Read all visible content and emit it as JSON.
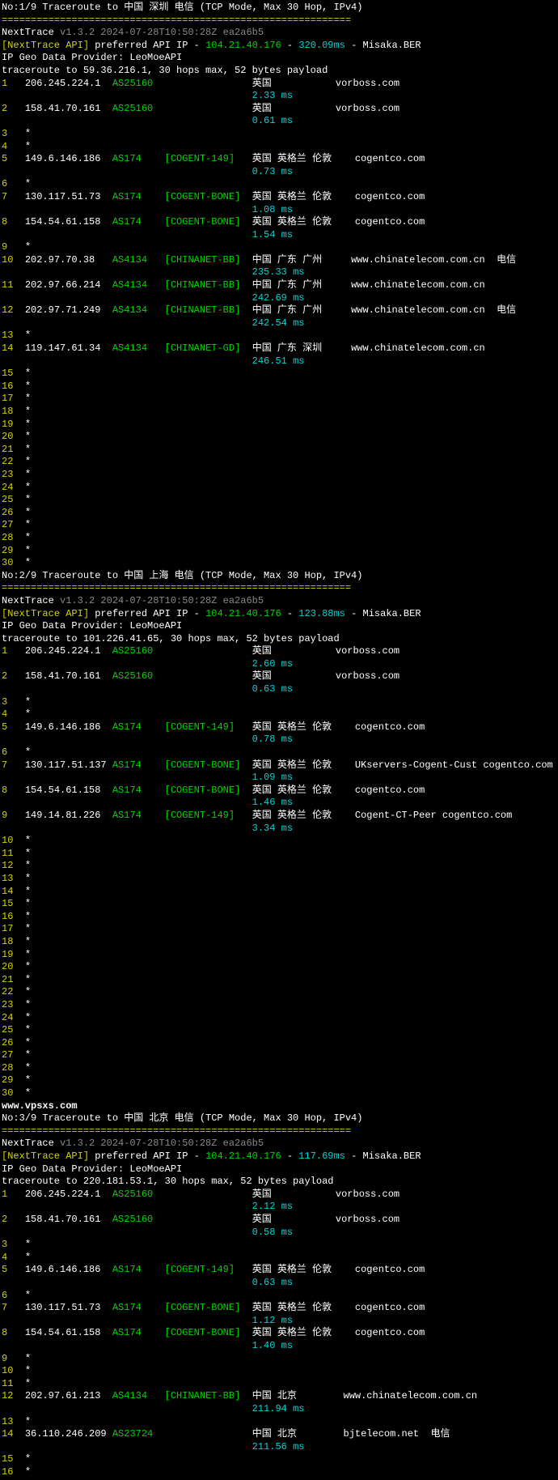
{
  "traces": [
    {
      "header": "No:1/9 Traceroute to 中国 深圳 电信 (TCP Mode, Max 30 Hop, IPv4)",
      "sep": "============================================================",
      "title": "NextTrace",
      "version": "v1.3.2 2024-07-28T10:50:28Z ea2a6b5",
      "api_label": "[NextTrace API]",
      "api_text": " preferred API IP - ",
      "api_ip": "104.21.40.176",
      "api_dash": " - ",
      "api_ms": "320.09ms",
      "api_suffix": " - Misaka.BER",
      "geo": "IP Geo Data Provider: LeoMoeAPI",
      "target": "traceroute to 59.36.216.1, 30 hops max, 52 bytes payload",
      "hops": [
        {
          "n": "1",
          "ip": "206.245.224.1",
          "as": "AS25160",
          "asname": "",
          "loc": "英国",
          "host": "vorboss.com",
          "ms": "2.33 ms"
        },
        {
          "n": "2",
          "ip": "158.41.70.161",
          "as": "AS25160",
          "asname": "",
          "loc": "英国",
          "host": "vorboss.com",
          "ms": "0.61 ms"
        },
        {
          "n": "3",
          "ip": "*",
          "star": true
        },
        {
          "n": "4",
          "ip": "*",
          "star": true
        },
        {
          "n": "5",
          "ip": "149.6.146.186",
          "as": "AS174",
          "asname": "[COGENT-149]",
          "loc": "英国 英格兰 伦敦",
          "host": "cogentco.com",
          "ms": "0.73 ms"
        },
        {
          "n": "6",
          "ip": "*",
          "star": true
        },
        {
          "n": "7",
          "ip": "130.117.51.73",
          "as": "AS174",
          "asname": "[COGENT-BONE]",
          "loc": "英国 英格兰 伦敦",
          "host": "cogentco.com",
          "ms": "1.08 ms"
        },
        {
          "n": "8",
          "ip": "154.54.61.158",
          "as": "AS174",
          "asname": "[COGENT-BONE]",
          "loc": "英国 英格兰 伦敦",
          "host": "cogentco.com",
          "ms": "1.54 ms"
        },
        {
          "n": "9",
          "ip": "*",
          "star": true
        },
        {
          "n": "10",
          "ip": "202.97.70.38",
          "as": "AS4134",
          "asname": "[CHINANET-BB]",
          "loc": "中国 广东 广州",
          "host": "www.chinatelecom.com.cn  电信",
          "ms": "235.33 ms"
        },
        {
          "n": "11",
          "ip": "202.97.66.214",
          "as": "AS4134",
          "asname": "[CHINANET-BB]",
          "loc": "中国 广东 广州",
          "host": "www.chinatelecom.com.cn",
          "ms": "242.69 ms"
        },
        {
          "n": "12",
          "ip": "202.97.71.249",
          "as": "AS4134",
          "asname": "[CHINANET-BB]",
          "loc": "中国 广东 广州",
          "host": "www.chinatelecom.com.cn  电信",
          "ms": "242.54 ms"
        },
        {
          "n": "13",
          "ip": "*",
          "star": true
        },
        {
          "n": "14",
          "ip": "119.147.61.34",
          "as": "AS4134",
          "asname": "[CHINANET-GD]",
          "loc": "中国 广东 深圳",
          "host": "www.chinatelecom.com.cn",
          "ms": "246.51 ms"
        },
        {
          "n": "15",
          "ip": "*",
          "star": true
        },
        {
          "n": "16",
          "ip": "*",
          "star": true
        },
        {
          "n": "17",
          "ip": "*",
          "star": true
        },
        {
          "n": "18",
          "ip": "*",
          "star": true
        },
        {
          "n": "19",
          "ip": "*",
          "star": true
        },
        {
          "n": "20",
          "ip": "*",
          "star": true
        },
        {
          "n": "21",
          "ip": "*",
          "star": true
        },
        {
          "n": "22",
          "ip": "*",
          "star": true
        },
        {
          "n": "23",
          "ip": "*",
          "star": true
        },
        {
          "n": "24",
          "ip": "*",
          "star": true
        },
        {
          "n": "25",
          "ip": "*",
          "star": true
        },
        {
          "n": "26",
          "ip": "*",
          "star": true
        },
        {
          "n": "27",
          "ip": "*",
          "star": true
        },
        {
          "n": "28",
          "ip": "*",
          "star": true
        },
        {
          "n": "29",
          "ip": "*",
          "star": true
        },
        {
          "n": "30",
          "ip": "*",
          "star": true
        }
      ]
    },
    {
      "header": "No:2/9 Traceroute to 中国 上海 电信 (TCP Mode, Max 30 Hop, IPv4)",
      "sep": "============================================================",
      "title": "NextTrace",
      "version": "v1.3.2 2024-07-28T10:50:28Z ea2a6b5",
      "api_label": "[NextTrace API]",
      "api_text": " preferred API IP - ",
      "api_ip": "104.21.40.176",
      "api_dash": " - ",
      "api_ms": "123.88ms",
      "api_suffix": " - Misaka.BER",
      "geo": "IP Geo Data Provider: LeoMoeAPI",
      "target": "traceroute to 101.226.41.65, 30 hops max, 52 bytes payload",
      "hops": [
        {
          "n": "1",
          "ip": "206.245.224.1",
          "as": "AS25160",
          "asname": "",
          "loc": "英国",
          "host": "vorboss.com",
          "ms": "2.60 ms"
        },
        {
          "n": "2",
          "ip": "158.41.70.161",
          "as": "AS25160",
          "asname": "",
          "loc": "英国",
          "host": "vorboss.com",
          "ms": "0.63 ms"
        },
        {
          "n": "3",
          "ip": "*",
          "star": true
        },
        {
          "n": "4",
          "ip": "*",
          "star": true
        },
        {
          "n": "5",
          "ip": "149.6.146.186",
          "as": "AS174",
          "asname": "[COGENT-149]",
          "loc": "英国 英格兰 伦敦",
          "host": "cogentco.com",
          "ms": "0.78 ms"
        },
        {
          "n": "6",
          "ip": "*",
          "star": true
        },
        {
          "n": "7",
          "ip": "130.117.51.137",
          "as": "AS174",
          "asname": "[COGENT-BONE]",
          "loc": "英国 英格兰 伦敦",
          "host": "UKservers-Cogent-Cust cogentco.com",
          "ms": "1.09 ms"
        },
        {
          "n": "8",
          "ip": "154.54.61.158",
          "as": "AS174",
          "asname": "[COGENT-BONE]",
          "loc": "英国 英格兰 伦敦",
          "host": "cogentco.com",
          "ms": "1.46 ms"
        },
        {
          "n": "9",
          "ip": "149.14.81.226",
          "as": "AS174",
          "asname": "[COGENT-149]",
          "loc": "英国 英格兰 伦敦",
          "host": "Cogent-CT-Peer cogentco.com",
          "ms": "3.34 ms"
        },
        {
          "n": "10",
          "ip": "*",
          "star": true
        },
        {
          "n": "11",
          "ip": "*",
          "star": true
        },
        {
          "n": "12",
          "ip": "*",
          "star": true
        },
        {
          "n": "13",
          "ip": "*",
          "star": true
        },
        {
          "n": "14",
          "ip": "*",
          "star": true
        },
        {
          "n": "15",
          "ip": "*",
          "star": true
        },
        {
          "n": "16",
          "ip": "*",
          "star": true
        },
        {
          "n": "17",
          "ip": "*",
          "star": true
        },
        {
          "n": "18",
          "ip": "*",
          "star": true
        },
        {
          "n": "19",
          "ip": "*",
          "star": true
        },
        {
          "n": "20",
          "ip": "*",
          "star": true
        },
        {
          "n": "21",
          "ip": "*",
          "star": true
        },
        {
          "n": "22",
          "ip": "*",
          "star": true
        },
        {
          "n": "23",
          "ip": "*",
          "star": true
        },
        {
          "n": "24",
          "ip": "*",
          "star": true
        },
        {
          "n": "25",
          "ip": "*",
          "star": true
        },
        {
          "n": "26",
          "ip": "*",
          "star": true
        },
        {
          "n": "27",
          "ip": "*",
          "star": true
        },
        {
          "n": "28",
          "ip": "*",
          "star": true
        },
        {
          "n": "29",
          "ip": "*",
          "star": true
        },
        {
          "n": "30",
          "ip": "*",
          "star": true
        }
      ],
      "watermark": "www.vpsxs.com"
    },
    {
      "header": "No:3/9 Traceroute to 中国 北京 电信 (TCP Mode, Max 30 Hop, IPv4)",
      "sep": "============================================================",
      "title": "NextTrace",
      "version": "v1.3.2 2024-07-28T10:50:28Z ea2a6b5",
      "api_label": "[NextTrace API]",
      "api_text": " preferred API IP - ",
      "api_ip": "104.21.40.176",
      "api_dash": " - ",
      "api_ms": "117.69ms",
      "api_suffix": " - Misaka.BER",
      "geo": "IP Geo Data Provider: LeoMoeAPI",
      "target": "traceroute to 220.181.53.1, 30 hops max, 52 bytes payload",
      "hops": [
        {
          "n": "1",
          "ip": "206.245.224.1",
          "as": "AS25160",
          "asname": "",
          "loc": "英国",
          "host": "vorboss.com",
          "ms": "2.12 ms"
        },
        {
          "n": "2",
          "ip": "158.41.70.161",
          "as": "AS25160",
          "asname": "",
          "loc": "英国",
          "host": "vorboss.com",
          "ms": "0.58 ms"
        },
        {
          "n": "3",
          "ip": "*",
          "star": true
        },
        {
          "n": "4",
          "ip": "*",
          "star": true
        },
        {
          "n": "5",
          "ip": "149.6.146.186",
          "as": "AS174",
          "asname": "[COGENT-149]",
          "loc": "英国 英格兰 伦敦",
          "host": "cogentco.com",
          "ms": "0.63 ms"
        },
        {
          "n": "6",
          "ip": "*",
          "star": true
        },
        {
          "n": "7",
          "ip": "130.117.51.73",
          "as": "AS174",
          "asname": "[COGENT-BONE]",
          "loc": "英国 英格兰 伦敦",
          "host": "cogentco.com",
          "ms": "1.12 ms"
        },
        {
          "n": "8",
          "ip": "154.54.61.158",
          "as": "AS174",
          "asname": "[COGENT-BONE]",
          "loc": "英国 英格兰 伦敦",
          "host": "cogentco.com",
          "ms": "1.40 ms"
        },
        {
          "n": "9",
          "ip": "*",
          "star": true
        },
        {
          "n": "10",
          "ip": "*",
          "star": true
        },
        {
          "n": "11",
          "ip": "*",
          "star": true
        },
        {
          "n": "12",
          "ip": "202.97.61.213",
          "as": "AS4134",
          "asname": "[CHINANET-BB]",
          "loc": "中国 北京",
          "host": "www.chinatelecom.com.cn",
          "ms": "211.94 ms"
        },
        {
          "n": "13",
          "ip": "*",
          "star": true
        },
        {
          "n": "14",
          "ip": "36.110.246.209",
          "as": "AS23724",
          "asname": "",
          "loc": "中国 北京",
          "host": "bjtelecom.net  电信",
          "ms": "211.56 ms"
        },
        {
          "n": "15",
          "ip": "*",
          "star": true
        },
        {
          "n": "16",
          "ip": "*",
          "star": true
        }
      ]
    }
  ]
}
